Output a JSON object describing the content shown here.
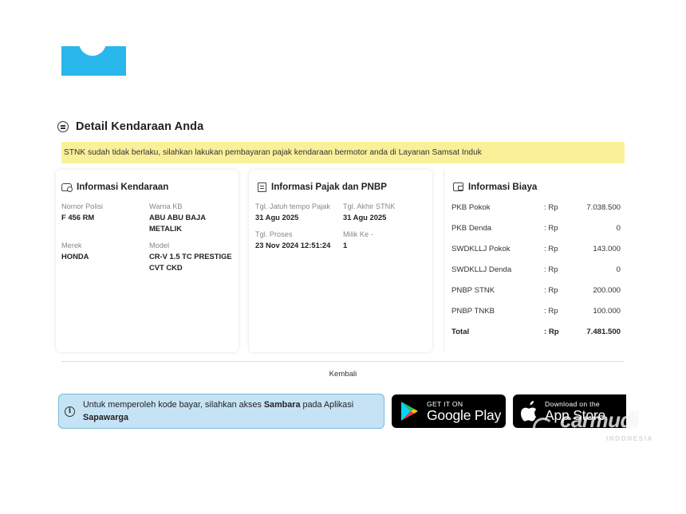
{
  "header": {
    "title": "Detail Kendaraan Anda"
  },
  "alert": {
    "text": "STNK sudah tidak berlaku, silahkan lakukan pembayaran pajak kendaraan bermotor anda di Layanan Samsat Induk",
    "color": "#fbf09a"
  },
  "vehicle_info": {
    "title": "Informasi Kendaraan",
    "icon": "car-icon",
    "fields": [
      {
        "label": "Nomor Polisi",
        "value": "F 456 RM"
      },
      {
        "label": "Warna KB",
        "value": "ABU ABU BAJA METALIK"
      },
      {
        "label": "Merek",
        "value": "HONDA"
      },
      {
        "label": "Model",
        "value": "CR-V 1.5 TC PRESTIGE CVT CKD"
      }
    ]
  },
  "tax_info": {
    "title": "Informasi Pajak dan PNBP",
    "icon": "document-icon",
    "fields": [
      {
        "label": "Tgl. Jatuh tempo Pajak",
        "value": "31 Agu 2025"
      },
      {
        "label": "Tgl. Akhir STNK",
        "value": "31 Agu 2025"
      },
      {
        "label": "Tgl. Proses",
        "value": "23 Nov 2024 12:51:24"
      },
      {
        "label": "Milik Ke -",
        "value": "1"
      }
    ]
  },
  "cost_info": {
    "title": "Informasi Biaya",
    "icon": "wallet-icon",
    "rows": [
      {
        "label": "PKB Pokok",
        "currency": ": Rp",
        "amount": "7.038.500"
      },
      {
        "label": "PKB Denda",
        "currency": ": Rp",
        "amount": "0"
      },
      {
        "label": "SWDKLLJ Pokok",
        "currency": ": Rp",
        "amount": "143.000"
      },
      {
        "label": "SWDKLLJ Denda",
        "currency": ": Rp",
        "amount": "0"
      },
      {
        "label": "PNBP STNK",
        "currency": ": Rp",
        "amount": "200.000"
      },
      {
        "label": "PNBP TNKB",
        "currency": ": Rp",
        "amount": "100.000"
      }
    ],
    "total": {
      "label": "Total",
      "currency": ": Rp",
      "amount": "7.481.500"
    }
  },
  "actions": {
    "back_label": "Kembali"
  },
  "info_box": {
    "text_before": "Untuk memperoleh kode bayar, silahkan akses ",
    "bold_app": "Sambara",
    "text_middle": " pada Aplikasi ",
    "bold_platform": "Sapawarga",
    "icon": "info-icon",
    "background": "#c6e3f6"
  },
  "stores": {
    "google": {
      "small": "GET IT ON",
      "big": "Google Play",
      "icon": "google-play-icon"
    },
    "apple": {
      "small": "Download on the",
      "big": "App Store",
      "icon": "apple-icon"
    }
  },
  "watermark": {
    "brand": "carmudi",
    "sub": "INDONESIA"
  },
  "colors": {
    "brand_blue": "#2ab8ec",
    "info_border": "#7bb8de"
  }
}
